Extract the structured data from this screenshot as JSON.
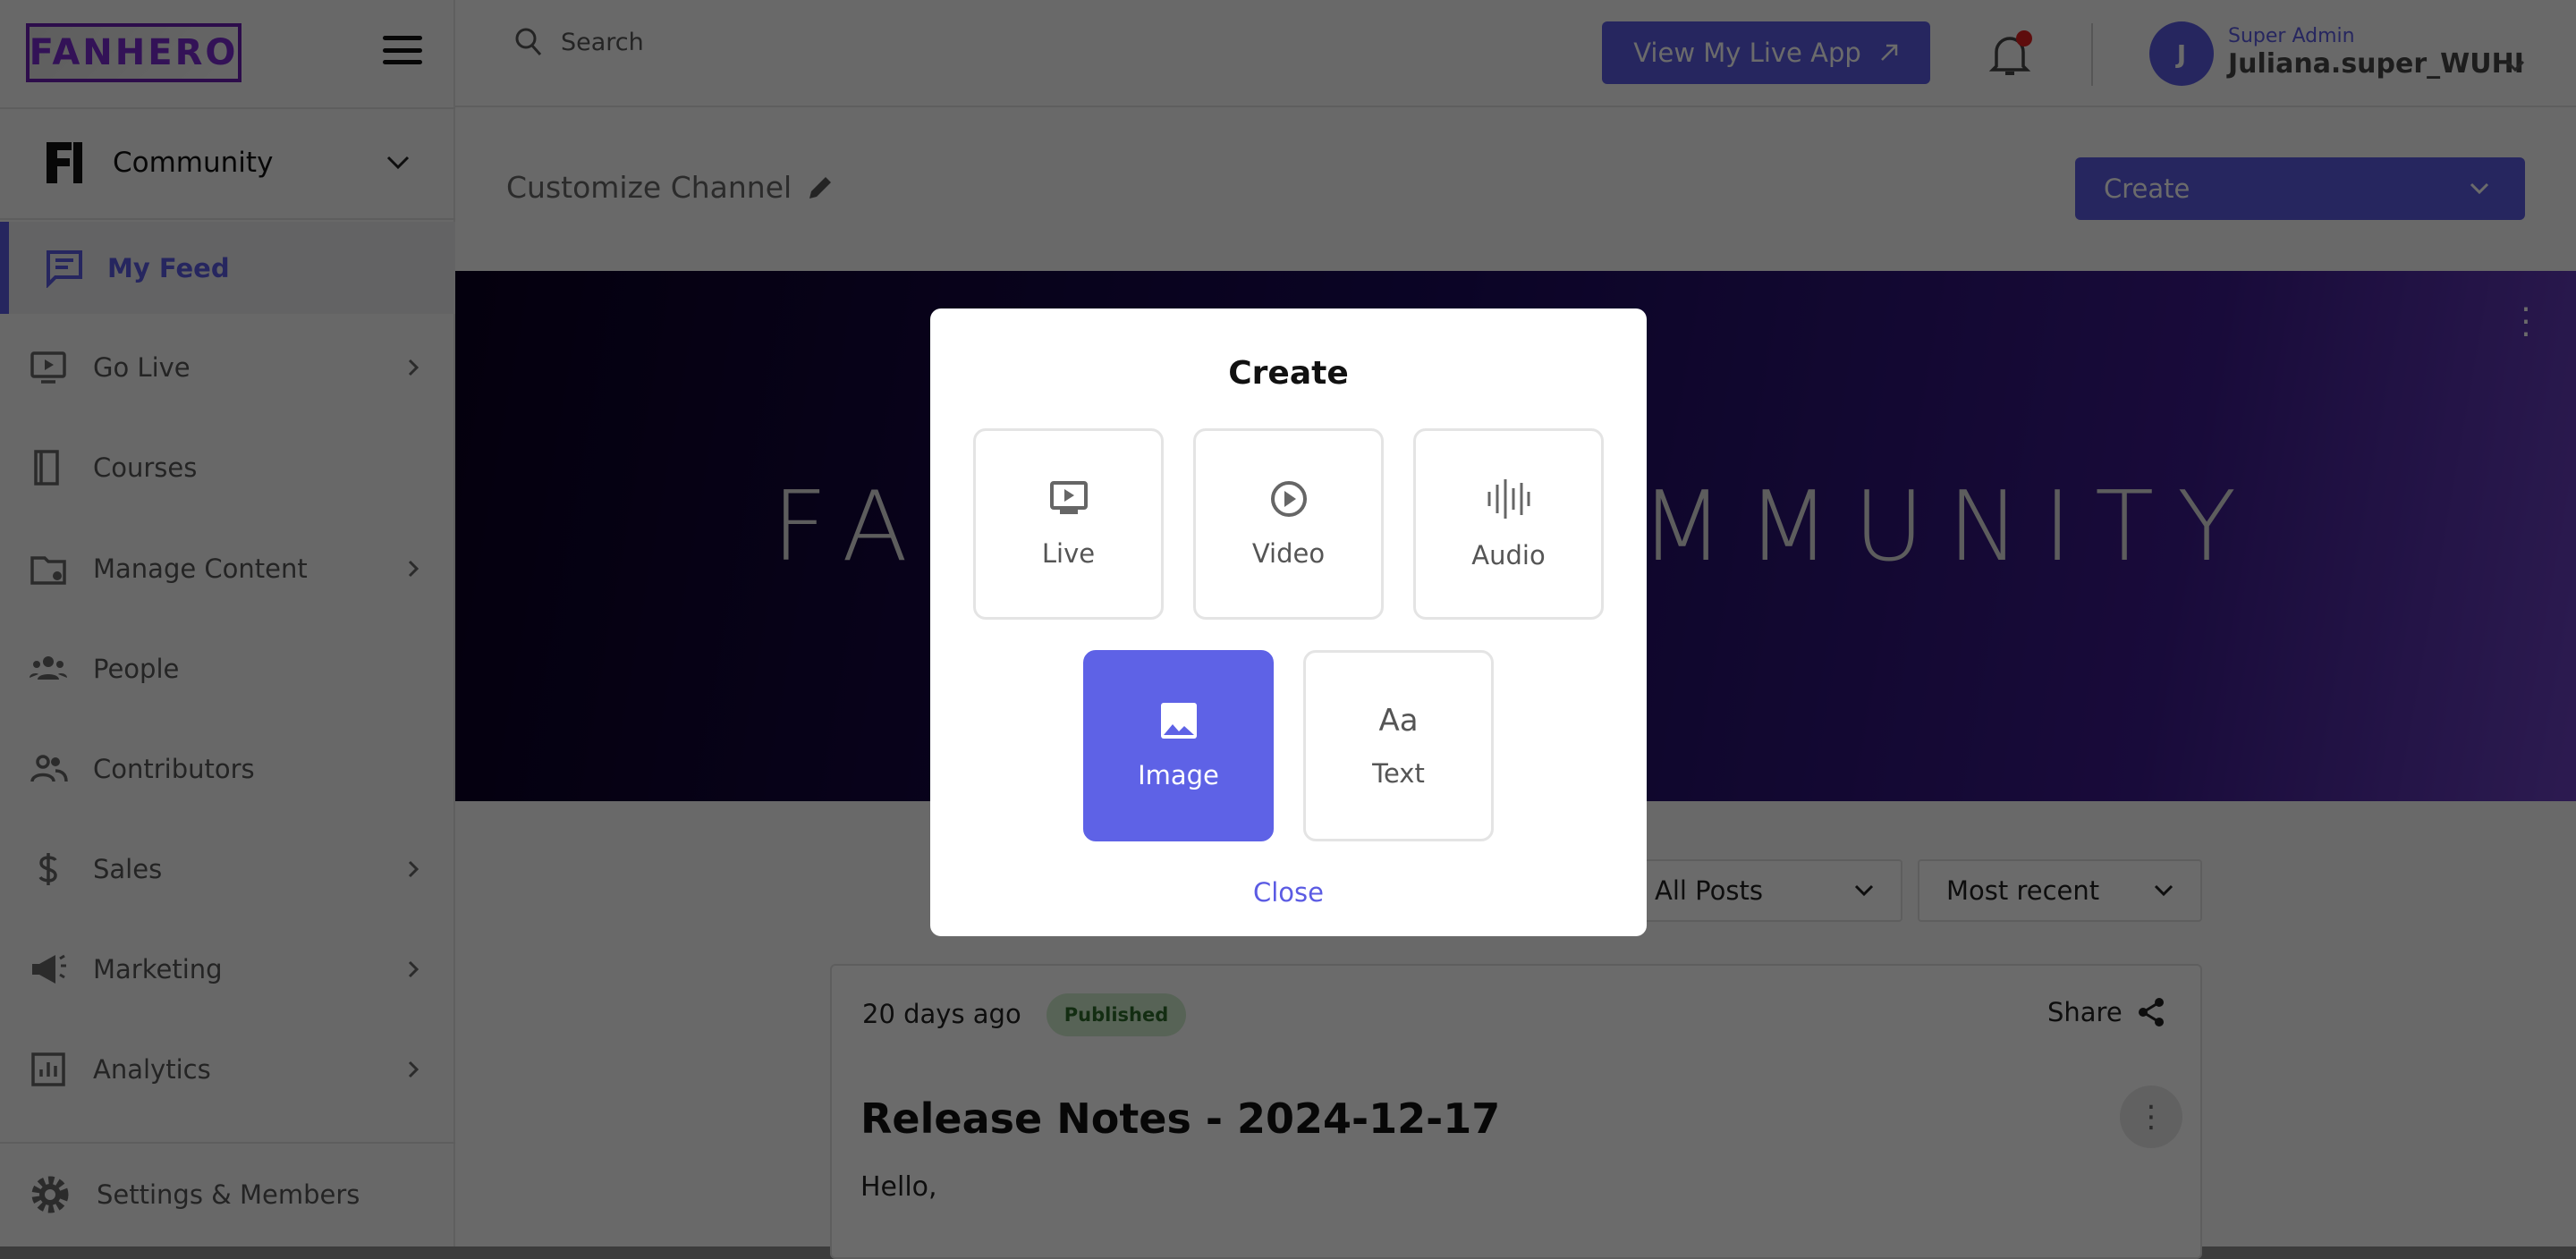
{
  "sidebar": {
    "logo": "FANHERO",
    "community": "Community",
    "active": "My Feed",
    "items": [
      {
        "label": "Go Live",
        "icon": "live-tv-icon",
        "chevron": true
      },
      {
        "label": "Courses",
        "icon": "book-icon",
        "chevron": false
      },
      {
        "label": "Manage Content",
        "icon": "folder-gear-icon",
        "chevron": true
      },
      {
        "label": "People",
        "icon": "people-icon",
        "chevron": false
      },
      {
        "label": "Contributors",
        "icon": "contributors-icon",
        "chevron": false
      },
      {
        "label": "Sales",
        "icon": "dollar-icon",
        "chevron": true
      },
      {
        "label": "Marketing",
        "icon": "megaphone-icon",
        "chevron": true
      },
      {
        "label": "Analytics",
        "icon": "analytics-icon",
        "chevron": true
      }
    ],
    "settings": "Settings & Members"
  },
  "header": {
    "search_placeholder": "Search",
    "view_app": "View My Live App",
    "role": "Super Admin",
    "username": "Juliana.super_WUHI",
    "avatar_initial": "J"
  },
  "page": {
    "customize": "Customize Channel",
    "create": "Create",
    "banner_text": "FANHERO COMMUNITY",
    "filter_type": "All Posts",
    "filter_sort": "Most recent"
  },
  "post": {
    "age": "20 days ago",
    "status": "Published",
    "share": "Share",
    "title": "Release Notes - 2024-12-17",
    "body": "Hello,"
  },
  "modal": {
    "title": "Create",
    "options": [
      "Live",
      "Video",
      "Audio",
      "Image",
      "Text"
    ],
    "selected": "Image",
    "text_glyph": "Aa",
    "close": "Close"
  },
  "colors": {
    "accent": "#5b5be3",
    "selected_tile": "#5e62e6",
    "notification": "#e02020",
    "published_bg": "#cfeccc"
  }
}
